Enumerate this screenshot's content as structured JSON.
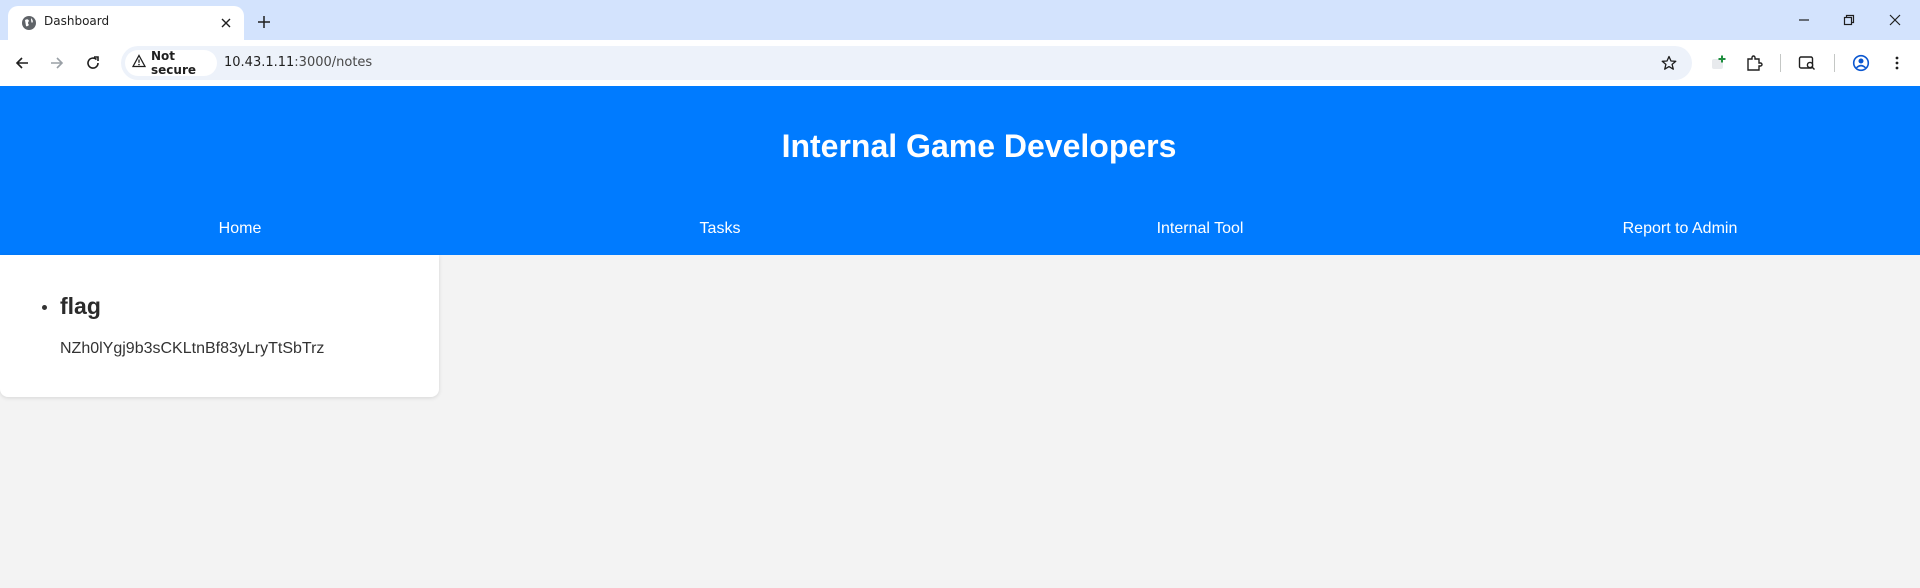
{
  "browser": {
    "tab": {
      "title": "Dashboard",
      "favicon": "globe-icon"
    },
    "address_bar": {
      "security_label": "Not secure",
      "url_host": "10.43.1.11",
      "url_path": ":3000/notes"
    }
  },
  "site": {
    "title": "Internal Game Developers",
    "nav": [
      "Home",
      "Tasks",
      "Internal Tool",
      "Report to Admin"
    ]
  },
  "notes": [
    {
      "title": "flag",
      "body": "NZh0lYgj9b3sCKLtnBf83yLryTtSbTrz"
    }
  ],
  "colors": {
    "header": "#007bff",
    "page_background": "#f3f3f3",
    "tabstrip": "#d3e3fd"
  }
}
